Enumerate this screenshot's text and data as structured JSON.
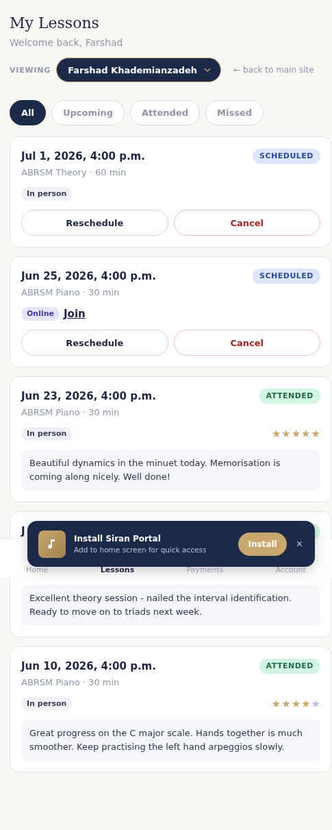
{
  "header": {
    "title": "My Lessons",
    "welcome": "Welcome back, Farshad",
    "viewing_label": "VIEWING",
    "student": "Farshad Khademianzadeh",
    "back_link": "← back to main site"
  },
  "filters": [
    {
      "label": "All",
      "selected": true
    },
    {
      "label": "Upcoming",
      "selected": false
    },
    {
      "label": "Attended",
      "selected": false
    },
    {
      "label": "Missed",
      "selected": false
    }
  ],
  "lessons": [
    {
      "date": "Jul 1, 2026, 4:00 p.m.",
      "status": {
        "kind": "scheduled",
        "label": "SCHEDULED"
      },
      "subtitle": "ABRSM Theory · 60 min",
      "mode": {
        "kind": "in_person",
        "label": "In person"
      },
      "actions": [
        "Reschedule",
        "Cancel"
      ]
    },
    {
      "date": "Jun 25, 2026, 4:00 p.m.",
      "status": {
        "kind": "scheduled",
        "label": "SCHEDULED"
      },
      "subtitle": "ABRSM Piano · 30 min",
      "mode": {
        "kind": "online",
        "label": "Online"
      },
      "join": "Join",
      "actions": [
        "Reschedule",
        "Cancel"
      ]
    },
    {
      "date": "Jun 23, 2026, 4:00 p.m.",
      "status": {
        "kind": "attended",
        "label": "ATTENDED"
      },
      "subtitle": "ABRSM Piano · 30 min",
      "mode": {
        "kind": "in_person",
        "label": "In person"
      },
      "stars": 5,
      "notes": "Beautiful dynamics in the minuet today. Memorisation is coming along nicely. Well done!"
    },
    {
      "date": "J",
      "status": {
        "kind": "attended"
      },
      "notes": "Excellent theory session - nailed the interval identification. Ready to move on to triads next week."
    },
    {
      "date": "Jun 10, 2026, 4:00 p.m.",
      "status": {
        "kind": "attended",
        "label": "ATTENDED"
      },
      "subtitle": "ABRSM Piano · 30 min",
      "mode": {
        "kind": "in_person",
        "label": "In person"
      },
      "stars": 4,
      "notes": "Great progress on the C major scale. Hands together is much smoother. Keep practising the left hand arpeggios slowly."
    }
  ],
  "bottom_nav": [
    {
      "label": "Home",
      "selected": false
    },
    {
      "label": "Lessons",
      "selected": true
    },
    {
      "label": "Payments",
      "selected": false
    },
    {
      "label": "Account",
      "selected": false
    }
  ],
  "install_banner": {
    "title": "Install Siran Portal",
    "subtitle": "Add to home screen for quick access",
    "button": "Install",
    "close": "×"
  }
}
